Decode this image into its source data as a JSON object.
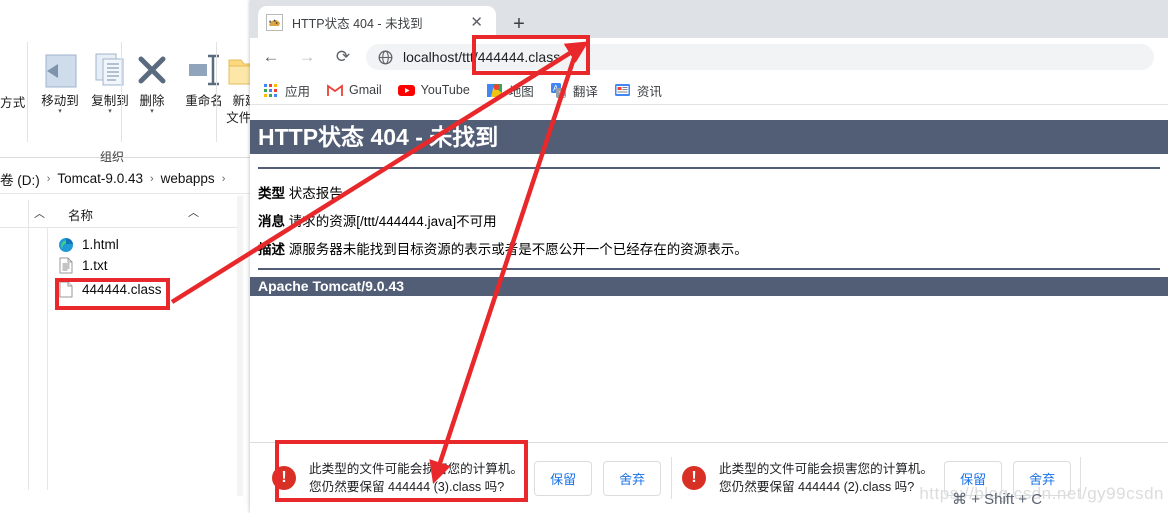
{
  "explorer": {
    "ribbon": {
      "left_partial_label": "方式",
      "items": [
        {
          "label": "移动到",
          "icon": "move-to-icon",
          "has_caret": true
        },
        {
          "label": "复制到",
          "icon": "copy-to-icon",
          "has_caret": true
        },
        {
          "label": "删除",
          "icon": "delete-icon",
          "has_caret": true
        },
        {
          "label": "重命名",
          "icon": "rename-icon",
          "has_caret": false
        },
        {
          "label": "新建\n文件夹",
          "label_line1": "新建",
          "label_line2": "文件夹",
          "icon": "new-folder-icon",
          "has_caret": false
        }
      ],
      "group_label": "组织"
    },
    "breadcrumb": {
      "parts": [
        "卷 (D:)",
        "Tomcat-9.0.43",
        "webapps"
      ],
      "separator": "›",
      "trailing_separator": "›"
    },
    "column_header": "名称",
    "files": [
      {
        "name": "1.html",
        "icon": "edge-browser-icon",
        "highlighted": false
      },
      {
        "name": "1.txt",
        "icon": "text-file-icon",
        "highlighted": false
      },
      {
        "name": "444444.class",
        "icon": "generic-file-icon",
        "highlighted": true
      }
    ]
  },
  "browser": {
    "tab": {
      "title": "HTTP状态 404 - 未找到",
      "favicon": "tomcat-cat-icon",
      "close_label": "✕"
    },
    "new_tab_label": "+",
    "nav": {
      "back": "←",
      "forward": "→",
      "reload": "⟳"
    },
    "omnibox": {
      "url": "localhost/ttt/444444.class",
      "icon": "globe-icon"
    },
    "bookmarks": [
      {
        "label": "应用",
        "icon": "apps-grid-icon"
      },
      {
        "label": "Gmail",
        "icon": "gmail-icon"
      },
      {
        "label": "YouTube",
        "icon": "youtube-icon"
      },
      {
        "label": "地图",
        "icon": "maps-icon"
      },
      {
        "label": "翻译",
        "icon": "translate-icon"
      },
      {
        "label": "资讯",
        "icon": "news-icon"
      }
    ]
  },
  "tomcat_page": {
    "heading": "HTTP状态 404 - 未找到",
    "type_label": "类型",
    "type_value": "状态报告",
    "message_label": "消息",
    "message_value": "请求的资源[/ttt/444444.java]不可用",
    "description_label": "描述",
    "description_value": "源服务器未能找到目标资源的表示或者是不愿公开一个已经存在的资源表示。",
    "footer": "Apache Tomcat/9.0.43",
    "header_color": "#525D76"
  },
  "download_shelf": {
    "items": [
      {
        "warn_icon": "warning-circle-icon",
        "line1": "此类型的文件可能会损害您的计算机。",
        "line2": "您仍然要保留 444444 (3).class 吗?",
        "keep_label": "保留",
        "discard_label": "舍弃"
      },
      {
        "warn_icon": "warning-circle-icon",
        "line1": "此类型的文件可能会损害您的计算机。",
        "line2": "您仍然要保留 444444 (2).class 吗?",
        "keep_label": "保留",
        "discard_label": "舍弃"
      }
    ]
  },
  "overlay": {
    "watermark": "https://blog.csdn.net/gy99csdn",
    "shortcut_hint": "⌘ + Shift + C",
    "annotation_color": "#e8282b"
  }
}
